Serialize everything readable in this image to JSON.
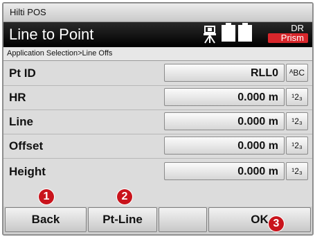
{
  "app": {
    "window_title": "Hilti POS"
  },
  "header": {
    "title": "Line to Point",
    "instrument_icon": "total-station-icon",
    "battery_icon": "battery-icon",
    "mode_top": "DR",
    "mode_bottom": "Prism"
  },
  "breadcrumb": "Application Selection>Line Offs",
  "fields": [
    {
      "label": "Pt ID",
      "value": "RLL0",
      "input_mode": "ᴬBC"
    },
    {
      "label": "HR",
      "value": "0.000 m",
      "input_mode": "¹2₃"
    },
    {
      "label": "Line",
      "value": "0.000 m",
      "input_mode": "¹2₃"
    },
    {
      "label": "Offset",
      "value": "0.000 m",
      "input_mode": "¹2₃"
    },
    {
      "label": "Height",
      "value": "0.000 m",
      "input_mode": "¹2₃"
    }
  ],
  "softkeys": {
    "back": "Back",
    "pt_line": "Pt-Line",
    "ok": "OK"
  },
  "callouts": [
    "1",
    "2",
    "3"
  ],
  "colors": {
    "header_bg": "#000000",
    "prism_badge": "#d8262b",
    "callout": "#c9141c"
  }
}
